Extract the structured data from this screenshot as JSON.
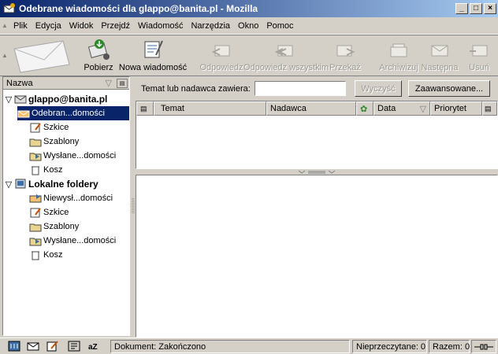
{
  "window": {
    "title": "Odebrane wiadomości dla glappo@banita.pl - Mozilla",
    "minimize": "_",
    "maximize": "□",
    "close": "×"
  },
  "menu": [
    "Plik",
    "Edycja",
    "Widok",
    "Przejdź",
    "Wiadomość",
    "Narzędzia",
    "Okno",
    "Pomoc"
  ],
  "toolbar": {
    "get": "Pobierz",
    "new": "Nowa wiadomość",
    "reply": "Odpowiedz",
    "reply_all": "Odpowiedz wszystkim",
    "forward": "Przekaż",
    "archive": "Archiwizuj",
    "next": "Następna",
    "delete": "Usuń"
  },
  "folders": {
    "header": "Nazwa",
    "account1": "glappo@banita.pl",
    "account1_items": [
      "Odebran...domości",
      "Szkice",
      "Szablony",
      "Wysłane...domości",
      "Kosz"
    ],
    "account2": "Lokalne foldery",
    "account2_items": [
      "Niewysł...domości",
      "Szkice",
      "Szablony",
      "Wysłane...domości",
      "Kosz"
    ]
  },
  "search": {
    "label": "Temat lub nadawca zawiera:",
    "value": "",
    "clear": "Wyczyść",
    "advanced": "Zaawansowane..."
  },
  "columns": {
    "subject": "Temat",
    "sender": "Nadawca",
    "date": "Data",
    "priority": "Priorytet"
  },
  "status": {
    "document": "Dokument: Zakończono",
    "unread": "Nieprzeczytane: 0",
    "total": "Razem: 0"
  }
}
